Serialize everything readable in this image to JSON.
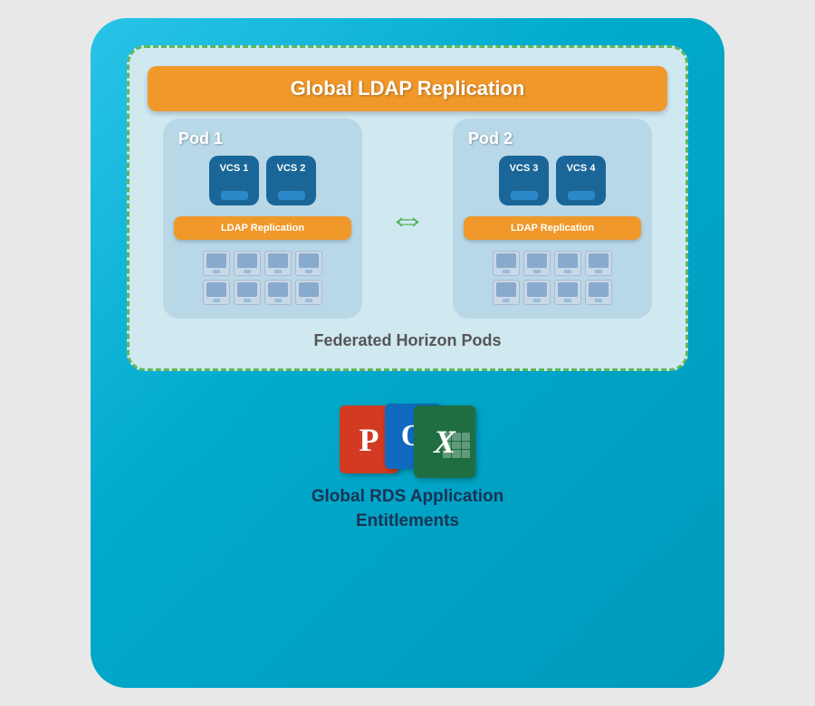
{
  "main": {
    "background_color": "#29c4e8"
  },
  "global_ldap": {
    "label": "Global LDAP Replication"
  },
  "pod1": {
    "label": "Pod 1",
    "vcs": [
      "VCS 1",
      "VCS 2"
    ],
    "ldap_replication": "LDAP Replication"
  },
  "pod2": {
    "label": "Pod 2",
    "vcs": [
      "VCS 3",
      "VCS 4"
    ],
    "ldap_replication": "LDAP Replication"
  },
  "federated_label": "Federated Horizon Pods",
  "global_rds": {
    "line1": "Global RDS Application",
    "line2": "Entitlements"
  },
  "icons": {
    "powerpoint": "P",
    "outlook": "O",
    "excel": "X"
  }
}
